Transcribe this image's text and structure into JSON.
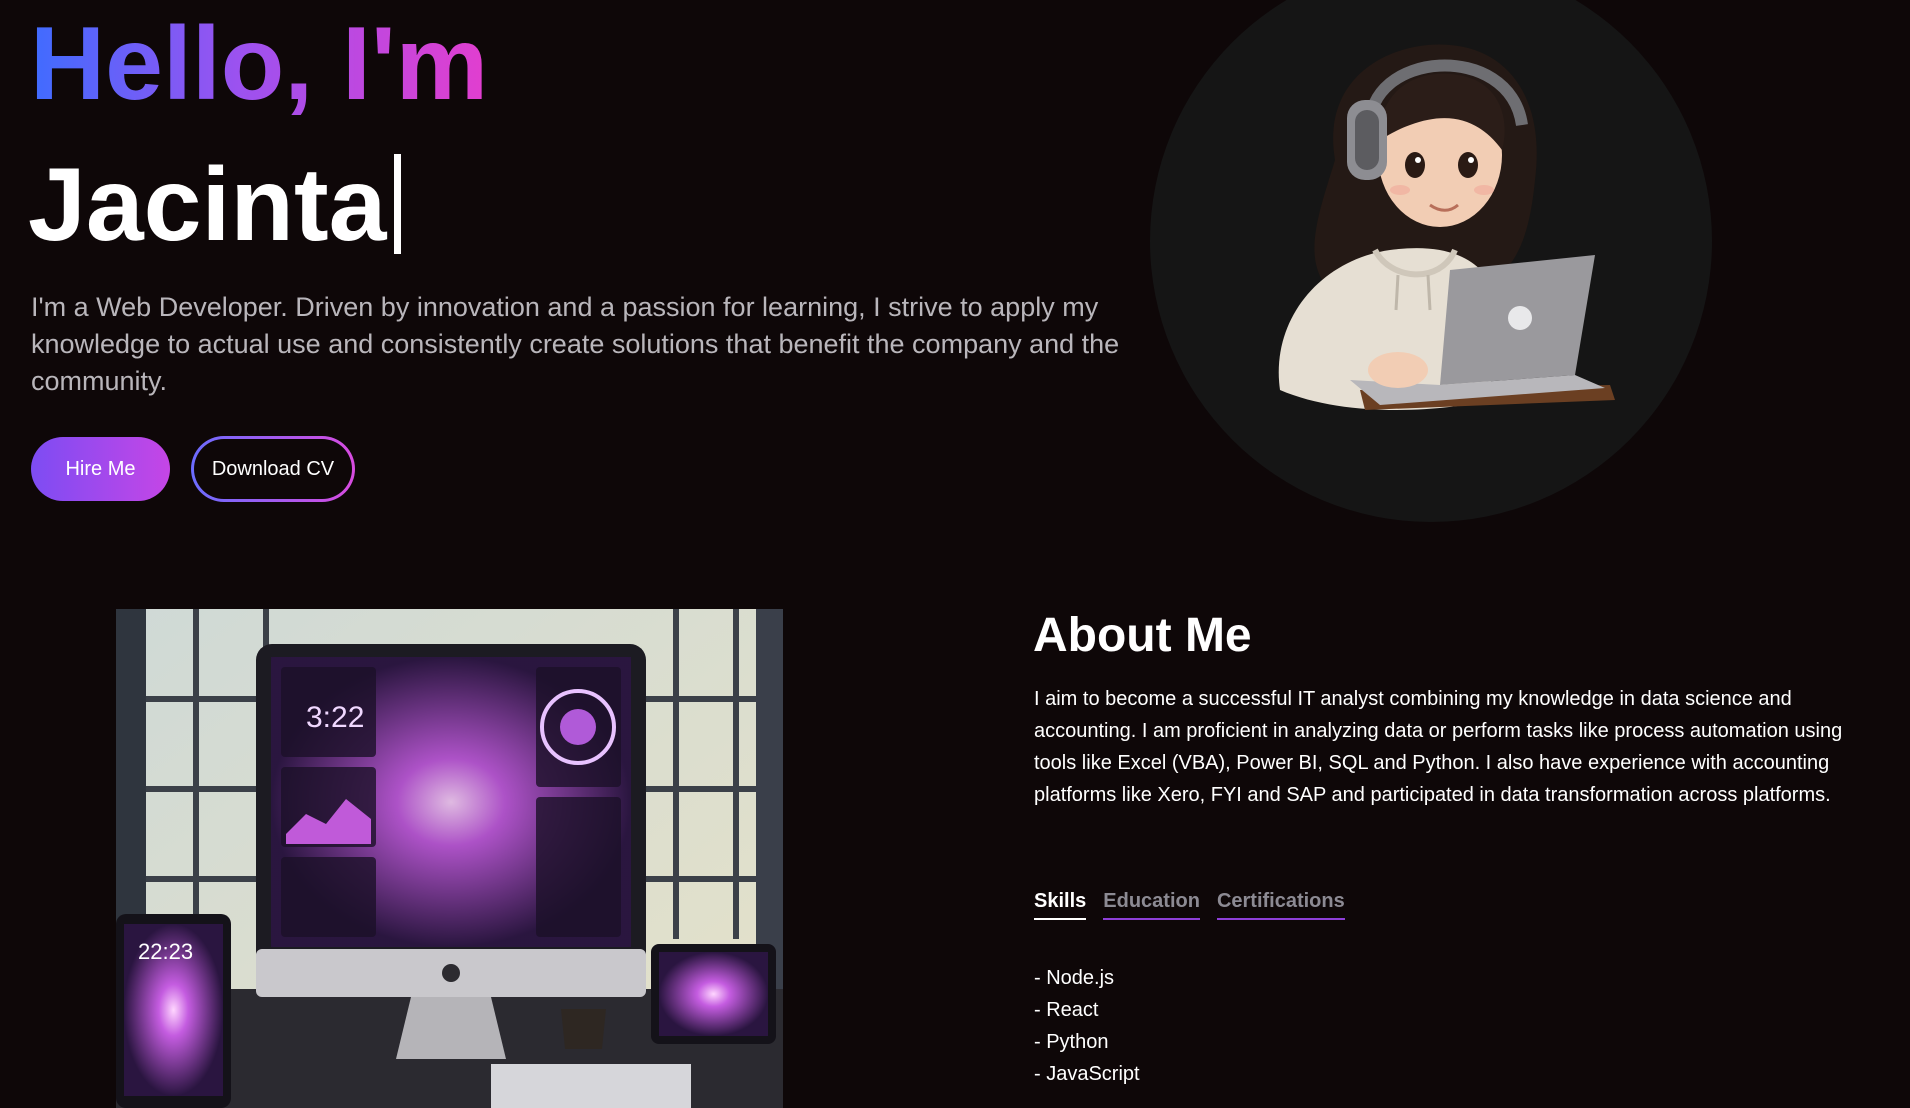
{
  "hero": {
    "greeting": "Hello, I'm",
    "name": "Jacinta",
    "intro": "I'm a Web Developer. Driven by innovation and a passion for learning, I strive to apply my knowledge to actual use and consistently create solutions that benefit the company and the community.",
    "hire_label": "Hire Me",
    "cv_label": "Download CV"
  },
  "about": {
    "title": "About Me",
    "text": "I aim to become a successful IT analyst combining my knowledge in data science and accounting. I am proficient in analyzing data or perform tasks like process automation using tools like Excel (VBA), Power BI, SQL and Python. I also have experience with accounting platforms like Xero, FYI and SAP and participated in data transformation across platforms.",
    "tabs": [
      "Skills",
      "Education",
      "Certifications"
    ],
    "active_tab": "Skills",
    "skills": [
      "- Node.js",
      "- React",
      "- Python",
      "- JavaScript"
    ]
  },
  "colors": {
    "background": "#0e0708",
    "gradient_start": "#3f6cff",
    "gradient_end": "#e23ecf",
    "tab_underline": "#8e3fd8"
  }
}
